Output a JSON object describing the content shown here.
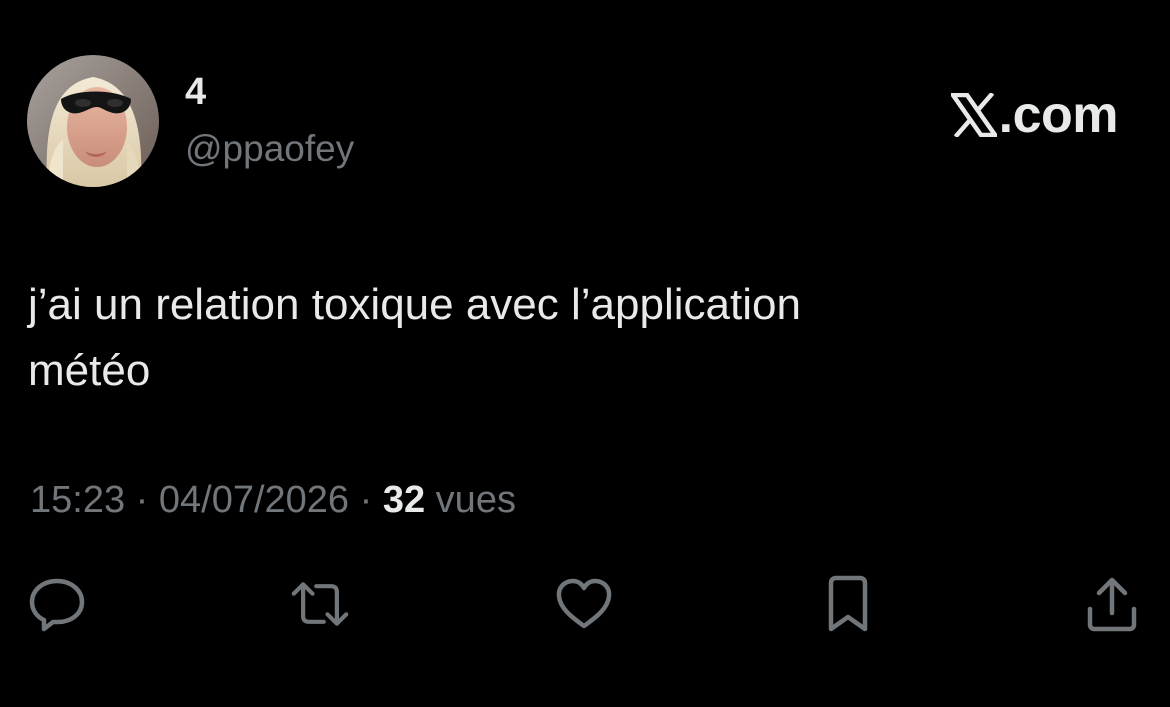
{
  "tweet": {
    "display_name": "4",
    "handle": "@ppaofey",
    "brand": ".com",
    "brand_icon": "x-logo-icon",
    "text_line1": "j’ai un relation toxique avec l’application",
    "text_line2": "météo",
    "time": "15:23",
    "separator": " · ",
    "date": "04/07/2026",
    "views_count": "32",
    "views_label": " vues"
  },
  "actions": [
    {
      "name": "reply",
      "icon": "comment-icon"
    },
    {
      "name": "repost",
      "icon": "repost-icon"
    },
    {
      "name": "like",
      "icon": "heart-icon"
    },
    {
      "name": "bookmark",
      "icon": "bookmark-icon"
    },
    {
      "name": "share",
      "icon": "share-icon"
    }
  ],
  "colors": {
    "background": "#000000",
    "primary_text": "#e7e9ea",
    "secondary_text": "#71767b"
  }
}
